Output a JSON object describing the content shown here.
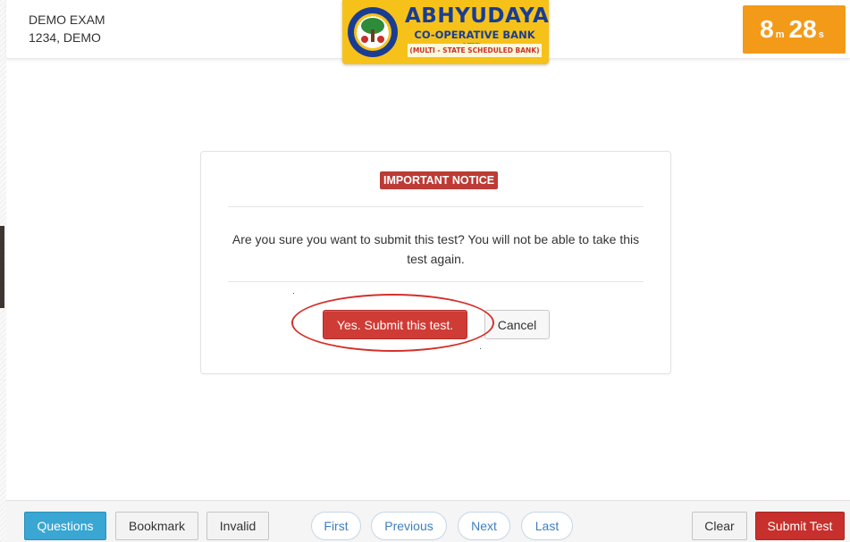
{
  "header": {
    "exam_name": "DEMO EXAM",
    "candidate": "1234, DEMO",
    "logo": {
      "title": "ABHYUDAYA",
      "subtitle": "CO-OPERATIVE BANK LTD.",
      "tagline": "(MULTI - STATE SCHEDULED BANK)",
      "seal_text": "ABHYUDAYA CO-OPERATIVE BANK LIMITED"
    },
    "timer": {
      "minutes": "8",
      "minutes_unit": "m",
      "seconds": "28",
      "seconds_unit": "s",
      "color": "#f39a19"
    }
  },
  "modal": {
    "badge": "IMPORTANT NOTICE",
    "message": "Are you sure you want to submit this test? You will not be able to take this test again.",
    "confirm_label": "Yes. Submit this test.",
    "cancel_label": "Cancel",
    "confirm_color": "#cf3b35",
    "highlight_color": "#d4312a"
  },
  "footer": {
    "questions_label": "Questions",
    "bookmark_label": "Bookmark",
    "invalid_label": "Invalid",
    "first_label": "First",
    "previous_label": "Previous",
    "next_label": "Next",
    "last_label": "Last",
    "clear_label": "Clear",
    "submit_label": "Submit Test",
    "questions_color": "#39a6d3",
    "submit_color": "#c7302c"
  }
}
